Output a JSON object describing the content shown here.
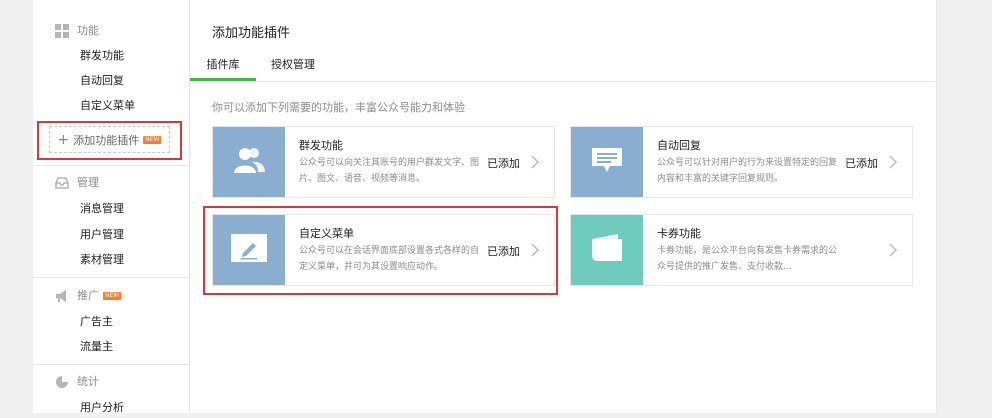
{
  "sidebar": {
    "sections": [
      {
        "title": "功能",
        "icon": "grid-icon",
        "items": [
          "群发功能",
          "自动回复",
          "自定义菜单"
        ]
      },
      {
        "title": "管理",
        "icon": "inbox-icon",
        "items": [
          "消息管理",
          "用户管理",
          "素材管理"
        ]
      },
      {
        "title": "推广",
        "icon": "megaphone-icon",
        "badge": "NEW",
        "items": [
          "广告主",
          "流量主"
        ]
      },
      {
        "title": "统计",
        "icon": "pie-chart-icon",
        "items": [
          "用户分析"
        ]
      }
    ],
    "add_plugin": {
      "label": "添加功能插件",
      "badge": "NEW"
    }
  },
  "main": {
    "title": "添加功能插件",
    "tabs": [
      {
        "label": "插件库",
        "active": true
      },
      {
        "label": "授权管理",
        "active": false
      }
    ],
    "hint": "你可以添加下列需要的功能，丰富公众号能力和体验",
    "cards": [
      {
        "title": "群发功能",
        "desc": "公众号可以向关注其账号的用户群发文字、图片、图文、语音、视频等消息。",
        "status": "已添加",
        "icon": "users-icon",
        "color": "#8aaed0"
      },
      {
        "title": "自动回复",
        "desc": "公众号可以针对用户的行为来设置特定的回复内容和丰富的关键字回复规则。",
        "status": "已添加",
        "icon": "chat-icon",
        "color": "#8aaed0"
      },
      {
        "title": "自定义菜单",
        "desc": "公众号可以在会话界面底部设置各式各样的自定义菜单，并可为其设置响应动作。",
        "status": "已添加",
        "icon": "edit-icon",
        "color": "#8aaed0"
      },
      {
        "title": "卡券功能",
        "desc": "卡券功能，是公众平台向有发售卡券需求的公众号提供的推广发售、支付收款...",
        "status": "",
        "icon": "card-icon",
        "color": "#6fcbbd"
      }
    ]
  },
  "colors": {
    "accent": "#44b549",
    "highlight": "#d9363e",
    "badge": "#ff7c2c"
  }
}
